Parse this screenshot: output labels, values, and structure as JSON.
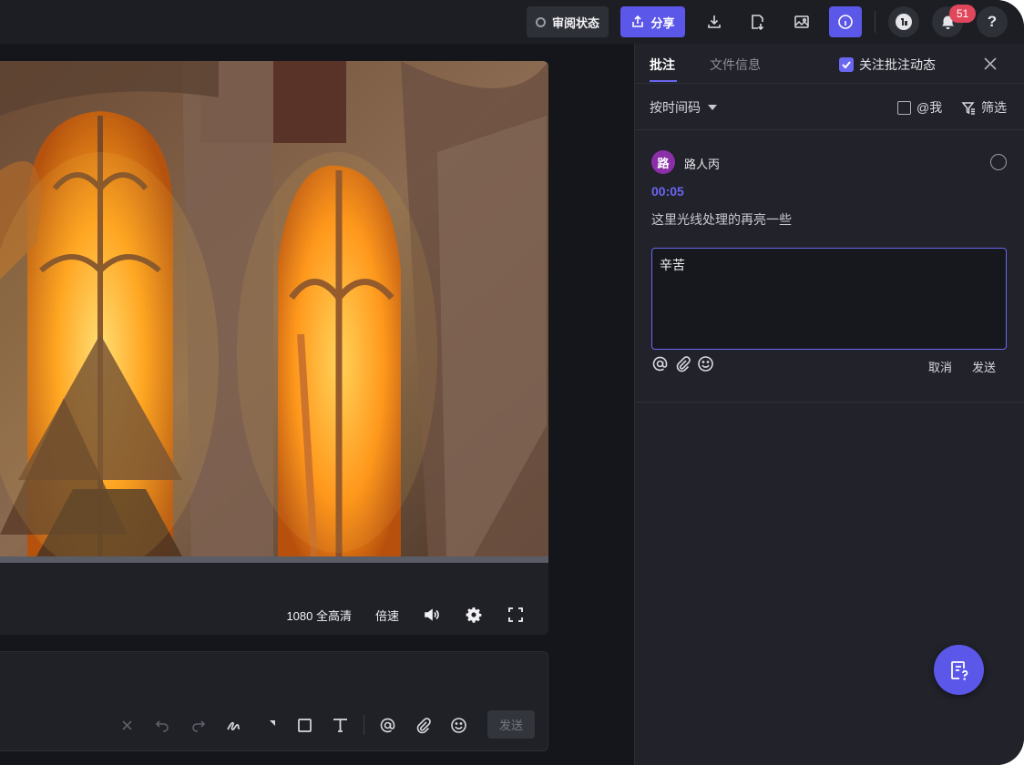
{
  "topbar": {
    "review_label": "审阅状态",
    "share_label": "分享",
    "notification_count": "51",
    "help_label": "?"
  },
  "video": {
    "quality_label": "1080 全高清",
    "speed_label": "倍速"
  },
  "composer": {
    "send_label": "发送"
  },
  "panel": {
    "tabs": [
      {
        "label": "批注",
        "active": true
      },
      {
        "label": "文件信息",
        "active": false
      }
    ],
    "follow_label": "关注批注动态",
    "sort_label": "按时间码",
    "at_me_label": "@我",
    "filter_label": "筛选"
  },
  "comment": {
    "avatar_letter": "路",
    "author": "路人丙",
    "timecode": "00:05",
    "text": "这里光线处理的再亮一些",
    "reply_value": "辛苦",
    "cancel_label": "取消",
    "send_label": "发送"
  },
  "colors": {
    "accent": "#5b57e8",
    "avatar": "#8b2fa8",
    "badge": "#e0475b",
    "background": "#15161b"
  }
}
